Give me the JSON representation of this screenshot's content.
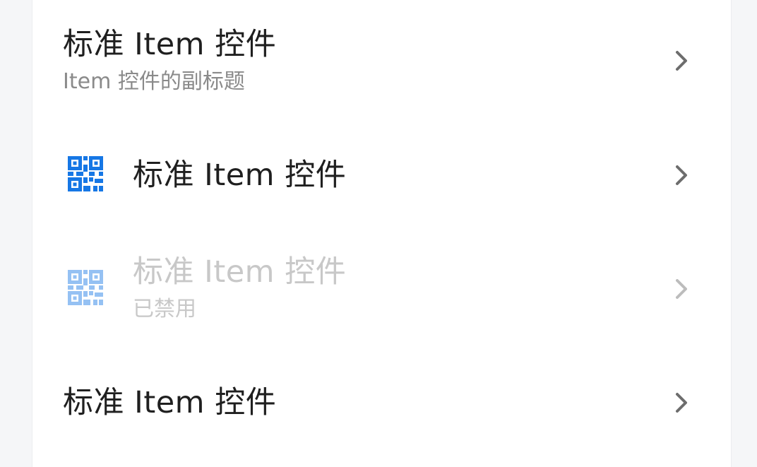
{
  "accent_color": "#1677e5",
  "items": [
    {
      "title": "标准 Item 控件",
      "subtitle": "Item 控件的副标题",
      "icon": null,
      "disabled": false,
      "trailing_icon": "chevron-right-icon"
    },
    {
      "title": "标准 Item 控件",
      "subtitle": "",
      "icon": "qr-code-icon",
      "disabled": false,
      "trailing_icon": "chevron-right-icon"
    },
    {
      "title": "标准 Item 控件",
      "subtitle": "已禁用",
      "icon": "qr-code-icon",
      "disabled": true,
      "trailing_icon": "chevron-right-icon"
    },
    {
      "title": "标准 Item 控件",
      "subtitle": "",
      "icon": null,
      "disabled": false,
      "trailing_icon": "chevron-right-icon"
    }
  ]
}
